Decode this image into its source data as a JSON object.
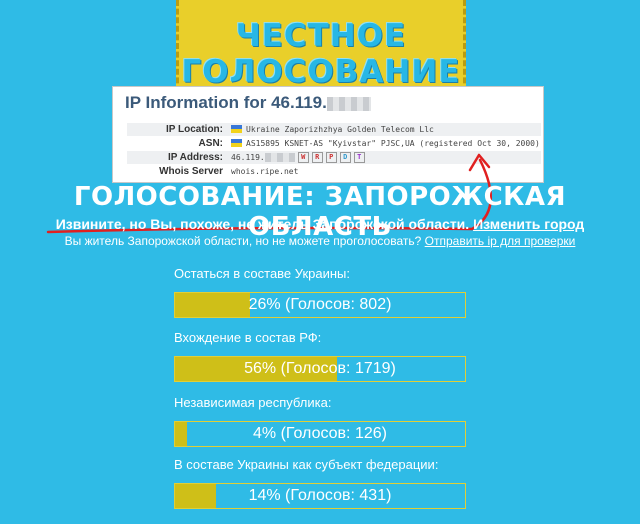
{
  "banner": {
    "line1": "ЧЕСТНОЕ",
    "line2": "ГОЛОСОВАНИЕ"
  },
  "ipinfo": {
    "title": "IP Information for 46.119.",
    "rows": [
      {
        "label": "IP Location:",
        "value": "Ukraine Zaporizhzhya Golden Telecom Llc",
        "flag": true
      },
      {
        "label": "ASN:",
        "value": "AS15895 KSNET-AS \"Kyivstar\" PJSC,UA (registered Oct 30, 2000)",
        "flag": true
      },
      {
        "label": "IP Address:",
        "value": "46.119.",
        "tags": [
          "W",
          "R",
          "P",
          "D",
          "T"
        ]
      },
      {
        "label": "Whois Server",
        "value": "whois.ripe.net"
      }
    ]
  },
  "headline": "ГОЛОСОВАНИЕ: ЗАПОРОЖСКАЯ ОБЛАСТЬ",
  "notice": {
    "text": "Извините, но Вы, похоже, не житель Запорожской области.",
    "link": "Изменить город"
  },
  "subnote": {
    "text": "Вы житель Запорожской области, но не можете проголосовать?",
    "link": "Отправить ip для проверки"
  },
  "poll": [
    {
      "label": "Остаться в составе Украины:",
      "percent": 26,
      "result": "26% (Голосов: 802)"
    },
    {
      "label": "Вхождение в состав РФ:",
      "percent": 56,
      "result": "56% (Голосов: 1719)"
    },
    {
      "label": "Независимая республика:",
      "percent": 4,
      "result": "4% (Голосов: 126)"
    },
    {
      "label": "В составе Украины как субъект федерации:",
      "percent": 14,
      "result": "14% (Голосов: 431)"
    }
  ],
  "colors": {
    "background": "#2fbbe6",
    "bar_fill": "#cfbf18",
    "annotation": "#e02020"
  }
}
